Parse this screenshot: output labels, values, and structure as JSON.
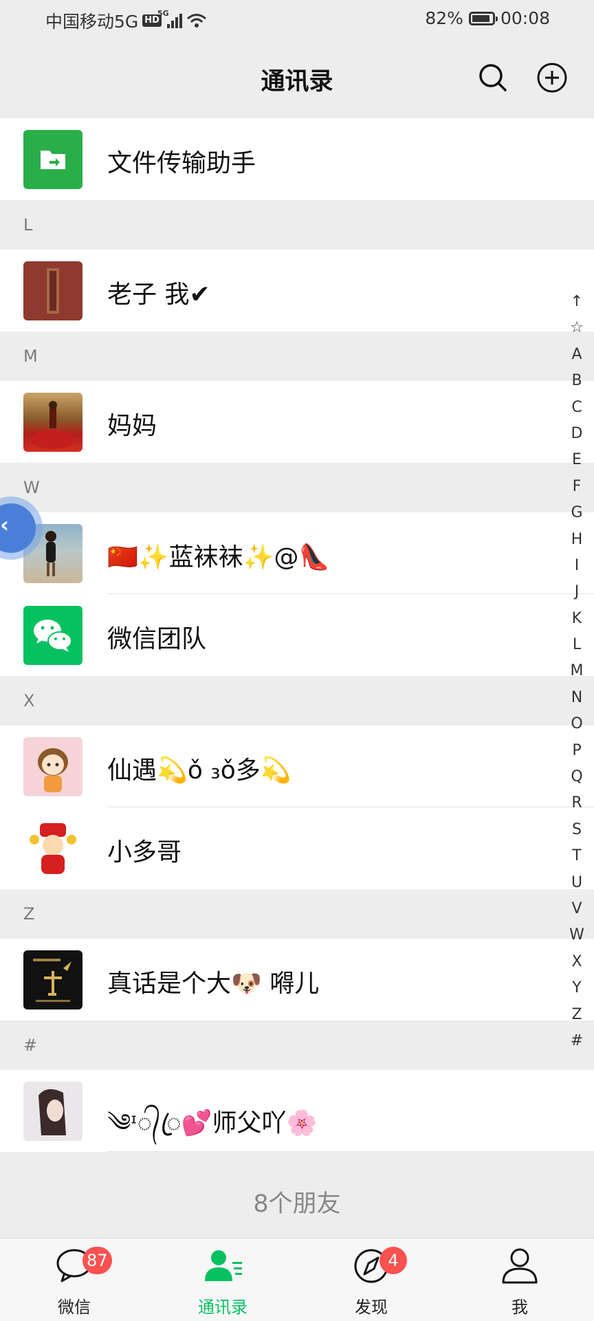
{
  "status_bar": {
    "carrier": "中国移动5G",
    "hd_badge": "HD",
    "signal_label": "5G",
    "battery": "82%",
    "time": "00:08",
    "battery_level": 0.82
  },
  "header": {
    "title": "通讯录",
    "search_icon": "search-icon",
    "add_icon": "add-circle-icon"
  },
  "top_entry": {
    "label": "文件传输助手",
    "icon": "folder-transfer-icon",
    "color": "#2aae4a"
  },
  "sections": [
    {
      "letter": "L",
      "contacts": [
        {
          "name": "老子 我✔"
        }
      ]
    },
    {
      "letter": "M",
      "contacts": [
        {
          "name": "妈妈"
        }
      ]
    },
    {
      "letter": "W",
      "contacts": [
        {
          "name": "🇨🇳✨蓝袜袜✨@👠"
        },
        {
          "name": "微信团队"
        }
      ]
    },
    {
      "letter": "X",
      "contacts": [
        {
          "name": "仙遇💫ǒ ₃ǒ多💫"
        },
        {
          "name": "小多哥"
        }
      ]
    },
    {
      "letter": "Z",
      "contacts": [
        {
          "name": "真话是个大🐶 嘚儿"
        }
      ]
    },
    {
      "letter": "#",
      "contacts": [
        {
          "name": "༄ᶦ᭄ꦿ💕师父吖🌸"
        }
      ]
    }
  ],
  "index_bar": [
    "↑",
    "☆",
    "A",
    "B",
    "C",
    "D",
    "E",
    "F",
    "G",
    "H",
    "I",
    "J",
    "K",
    "L",
    "M",
    "N",
    "O",
    "P",
    "Q",
    "R",
    "S",
    "T",
    "U",
    "V",
    "W",
    "X",
    "Y",
    "Z",
    "#"
  ],
  "footer": {
    "friend_count": "8个朋友"
  },
  "tabs": [
    {
      "label": "微信",
      "icon": "chat-bubble-icon",
      "badge": "87"
    },
    {
      "label": "通讯录",
      "icon": "contacts-icon",
      "active": true
    },
    {
      "label": "发现",
      "icon": "compass-icon",
      "badge": "4"
    },
    {
      "label": "我",
      "icon": "person-icon"
    }
  ],
  "colors": {
    "accent": "#07c160",
    "badge": "#fa5151",
    "background": "#ededed"
  }
}
